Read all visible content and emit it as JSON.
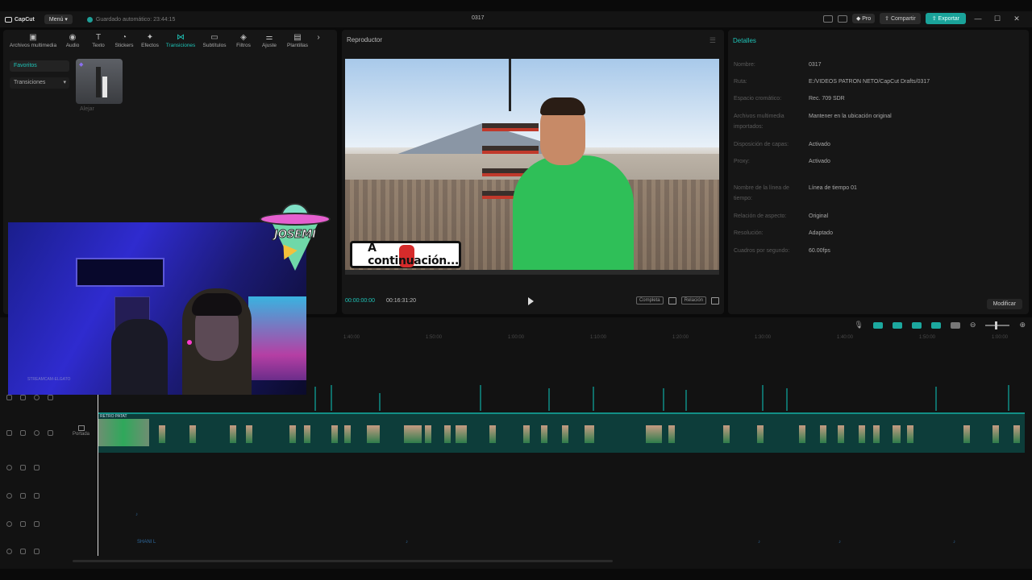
{
  "titlebar": {
    "app_name": "CapCut",
    "menu_label": "Menú",
    "autosave_text": "Guardado automático: 23:44:15",
    "project_title": "0317",
    "pro_label": "Pro",
    "share_label": "Compartir",
    "export_label": "Exportar"
  },
  "toolbar": {
    "items": [
      {
        "label": "Archivos multimedia",
        "icon": "media-icon"
      },
      {
        "label": "Audio",
        "icon": "audio-icon"
      },
      {
        "label": "Texto",
        "icon": "text-icon"
      },
      {
        "label": "Stickers",
        "icon": "sticker-icon"
      },
      {
        "label": "Efectos",
        "icon": "effects-icon"
      },
      {
        "label": "Transiciones",
        "icon": "transitions-icon"
      },
      {
        "label": "Subtítulos",
        "icon": "subtitles-icon"
      },
      {
        "label": "Filtros",
        "icon": "filters-icon"
      },
      {
        "label": "Ajuste",
        "icon": "adjust-icon"
      },
      {
        "label": "Plantillas",
        "icon": "templates-icon"
      }
    ]
  },
  "sidebar": {
    "items": [
      {
        "label": "Favoritos"
      },
      {
        "label": "Transiciones"
      }
    ]
  },
  "library": {
    "item_label": "Alejar"
  },
  "player": {
    "title": "Reproductor",
    "caption": "A continuación...",
    "current_time": "00:00:00:00",
    "total_time": "00:16:31:20",
    "full_label": "Completa",
    "ratio_label": "Relación"
  },
  "details": {
    "title": "Detalles",
    "rows": [
      {
        "label": "Nombre:",
        "value": "0317"
      },
      {
        "label": "Ruta:",
        "value": "E:/VIDEOS PATRON NETO/CapCut Drafts/0317"
      },
      {
        "label": "Espacio cromático:",
        "value": "Rec. 709 SDR"
      },
      {
        "label": "Archivos multimedia importados:",
        "value": "Mantener en la ubicación original"
      },
      {
        "label": "Disposición de capas:",
        "value": "Activado"
      },
      {
        "label": "Proxy:",
        "value": "Activado"
      },
      {
        "label": "Nombre de la línea de tiempo:",
        "value": "Línea de tiempo 01"
      },
      {
        "label": "Relación de aspecto:",
        "value": "Original"
      },
      {
        "label": "Resolución:",
        "value": "Adaptado"
      },
      {
        "label": "Cuadros por segundo:",
        "value": "60.00fps"
      }
    ],
    "modify_label": "Modificar"
  },
  "timeline": {
    "ticks": [
      "1:40:00",
      "1:50:00",
      "1:00:00",
      "1:10:00",
      "1:20:00",
      "1:30:00",
      "1:40:00",
      "1:50:00",
      "1:00:00"
    ],
    "cover_label": "Portada",
    "first_clip_label": "RETRO PATAT",
    "sub_label": "SHANI L"
  },
  "overlay": {
    "streamer_name": "JOSEMI",
    "cam_label": "STREAMCAM-ELGATO"
  }
}
